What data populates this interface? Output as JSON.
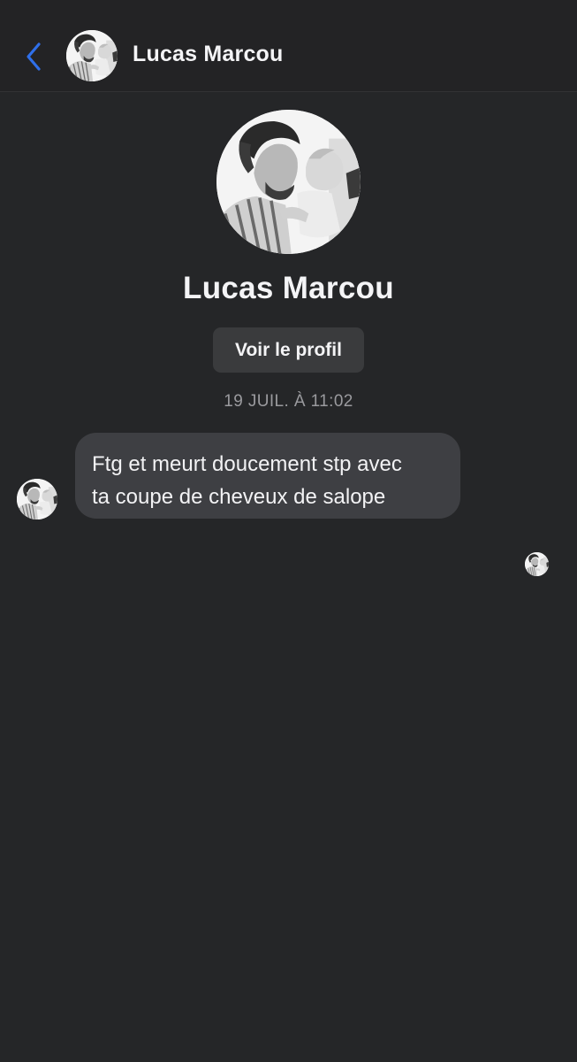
{
  "header": {
    "back_icon": "chevron-left-icon",
    "contact_name": "Lucas Marcou",
    "accent_color": "#2f6fea"
  },
  "profile": {
    "name": "Lucas Marcou",
    "view_profile_label": "Voir le profil"
  },
  "conversation": {
    "timestamp": "19 JUIL. À 11:02",
    "messages": [
      {
        "direction": "incoming",
        "lines": [
          "Ftg et meurt doucement stp avec",
          "ta coupe de cheveux de salope"
        ]
      }
    ],
    "seen_indicator": "avatar"
  }
}
